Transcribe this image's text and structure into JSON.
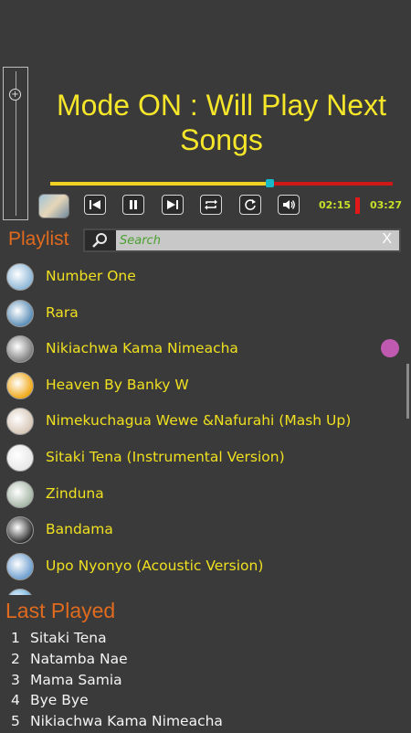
{
  "mode_banner": "Mode ON : Will Play Next Songs",
  "player": {
    "progress_fraction": 0.64,
    "elapsed": "02:15",
    "total": "03:27",
    "controls": [
      "previous-icon",
      "pause-icon",
      "next-icon",
      "repeat-icon",
      "refresh-icon",
      "volume-icon"
    ]
  },
  "playlist": {
    "title": "Playlist",
    "search_placeholder": "Search",
    "clear_label": "X",
    "items": [
      {
        "name": "Number One",
        "thumb": "#8fb8d8"
      },
      {
        "name": "Rara",
        "thumb": "#5d8fb8"
      },
      {
        "name": "Nikiachwa Kama Nimeacha",
        "thumb": "#808080",
        "active": true
      },
      {
        "name": "Heaven By Banky W",
        "thumb": "#f0a818"
      },
      {
        "name": "Nimekuchagua Wewe &Nafurahi (Mash Up)",
        "thumb": "#d8c8b8"
      },
      {
        "name": "Sitaki Tena (Instrumental Version)",
        "thumb": "#e8e8e8"
      },
      {
        "name": "Zinduna",
        "thumb": "#a8b8a8"
      },
      {
        "name": "Bandama",
        "thumb": "#303030"
      },
      {
        "name": "Upo Nyonyo (Acoustic Version)",
        "thumb": "#70a0d0"
      },
      {
        "name": "",
        "thumb": "#6ab0e0"
      }
    ]
  },
  "last_played": {
    "title": "Last Played",
    "items": [
      {
        "num": "1",
        "name": "Sitaki Tena"
      },
      {
        "num": "2",
        "name": "Natamba Nae"
      },
      {
        "num": "3",
        "name": "Mama Samia"
      },
      {
        "num": "4",
        "name": "Bye Bye"
      },
      {
        "num": "5",
        "name": "Nikiachwa Kama Nimeacha"
      }
    ]
  }
}
